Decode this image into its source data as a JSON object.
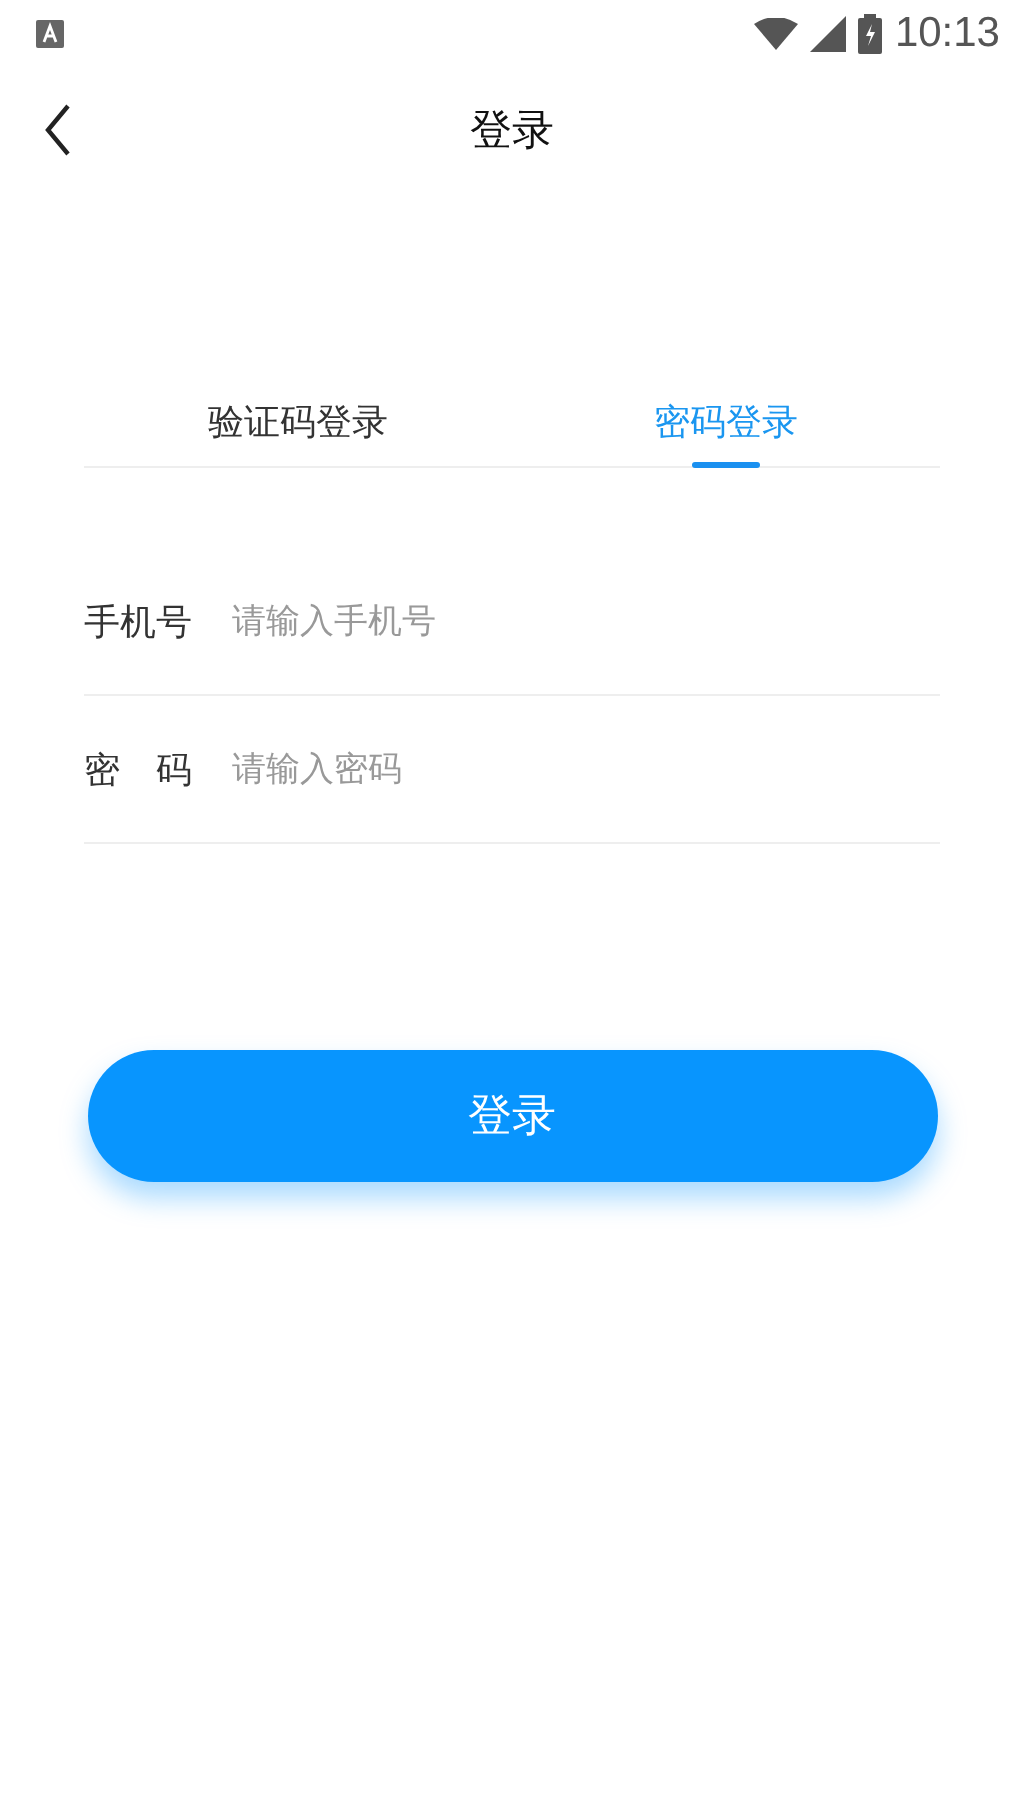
{
  "status_bar": {
    "time": "10:13"
  },
  "header": {
    "title": "登录"
  },
  "tabs": [
    {
      "label": "验证码登录",
      "selected": false
    },
    {
      "label": "密码登录",
      "selected": true
    }
  ],
  "fields": [
    {
      "label": "手机号",
      "placeholder": "请输入手机号"
    },
    {
      "label": "密　码",
      "placeholder": "请输入密码"
    }
  ],
  "submit": {
    "label": "登录"
  }
}
